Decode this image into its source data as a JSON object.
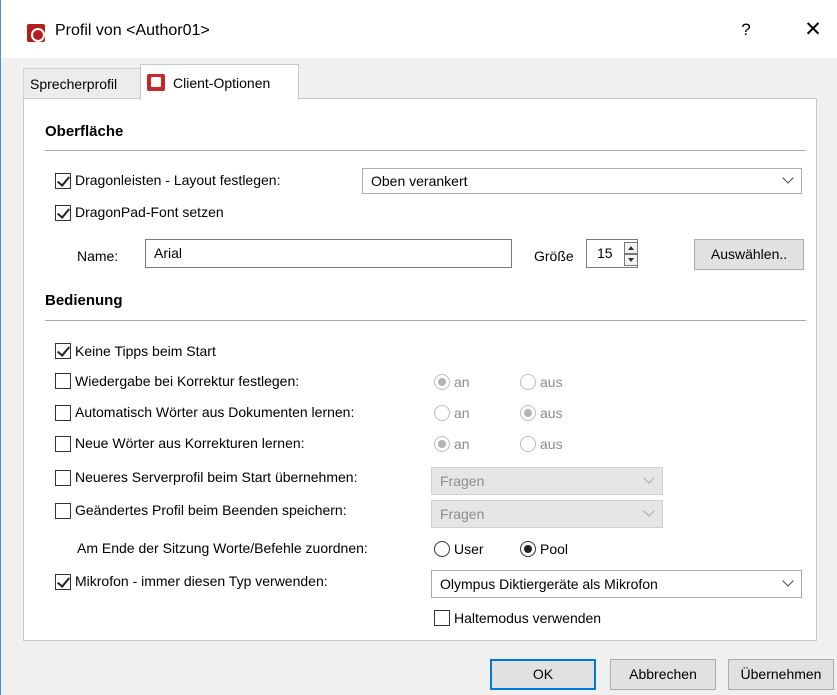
{
  "window": {
    "title": "Profil von <Author01>",
    "help_label": "?",
    "close_label": "✕",
    "accent_color": "#0078d7"
  },
  "tabs": [
    {
      "label": "Sprecherprofil",
      "active": false
    },
    {
      "label": "Client-Optionen",
      "active": true
    }
  ],
  "oberflaeche": {
    "title": "Oberfläche",
    "layout_checkbox": {
      "label": "Dragonleisten - Layout festlegen:",
      "checked": true
    },
    "layout_select": {
      "value": "Oben verankert"
    },
    "font_checkbox": {
      "label": "DragonPad-Font setzen",
      "checked": true
    },
    "name_label": "Name:",
    "name_value": "Arial",
    "size_label": "Größe",
    "size_value": "15",
    "choose_button": "Auswählen.."
  },
  "bedienung": {
    "title": "Bedienung",
    "tips": {
      "label": "Keine Tipps beim Start",
      "checked": true
    },
    "playback": {
      "label": "Wiedergabe bei Korrektur festlegen:",
      "checked": false,
      "on_label": "an",
      "off_label": "aus",
      "selected": "an",
      "enabled": false
    },
    "auto_learn": {
      "label": "Automatisch Wörter aus Dokumenten lernen:",
      "checked": false,
      "on_label": "an",
      "off_label": "aus",
      "selected": "aus",
      "enabled": false
    },
    "new_words": {
      "label": "Neue Wörter aus Korrekturen lernen:",
      "checked": false,
      "on_label": "an",
      "off_label": "aus",
      "selected": "an",
      "enabled": false
    },
    "server_profile": {
      "label": "Neueres Serverprofil beim Start übernehmen:",
      "checked": false,
      "select_value": "Fragen"
    },
    "save_profile": {
      "label": "Geändertes Profil beim Beenden speichern:",
      "checked": false,
      "select_value": "Fragen"
    },
    "assign": {
      "label": "Am Ende der Sitzung Worte/Befehle zuordnen:",
      "user_label": "User",
      "pool_label": "Pool",
      "selected": "Pool"
    },
    "microphone": {
      "label": "Mikrofon - immer diesen Typ verwenden:",
      "checked": true,
      "select_value": "Olympus Diktiergeräte als Mikrofon"
    },
    "hold_mode": {
      "label": "Haltemodus verwenden",
      "checked": false
    }
  },
  "footer": {
    "ok": "OK",
    "cancel": "Abbrechen",
    "apply": "Übernehmen"
  }
}
